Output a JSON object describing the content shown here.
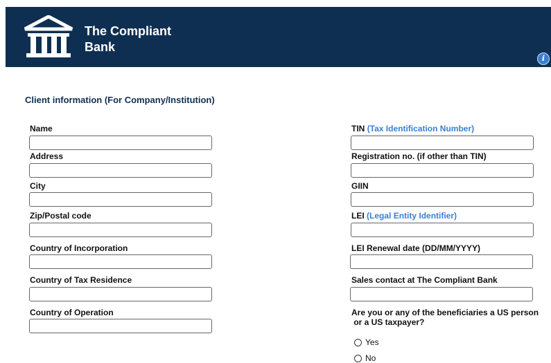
{
  "header": {
    "bank_name_line1": "The Compliant",
    "bank_name_line2": "Bank",
    "logo_icon": "bank-building-icon",
    "info_icon": "info-icon"
  },
  "section": {
    "title": "Client information (For Company/Institution)"
  },
  "left_fields": {
    "name": "Name",
    "address": "Address",
    "city": "City",
    "zip": "Zip/Postal code",
    "country_incorporation": "Country of Incorporation",
    "country_tax": "Country of Tax Residence",
    "country_operation": "Country of Operation"
  },
  "right_fields": {
    "tin": "TIN",
    "tin_hint": "(Tax Identification Number)",
    "registration": "Registration no. (if other than TIN)",
    "giin": "GIIN",
    "lei": "LEI",
    "lei_hint": "(Legal Entity Identifier)",
    "lei_renewal": "LEI Renewal date (DD/MM/YYYY)",
    "sales_contact": "Sales contact at The Compliant Bank",
    "us_person_q1": "Are you or any of the beneficiaries a US person",
    "us_person_q2": " or a US taxpayer?",
    "option_yes": "Yes",
    "option_no": "No"
  }
}
